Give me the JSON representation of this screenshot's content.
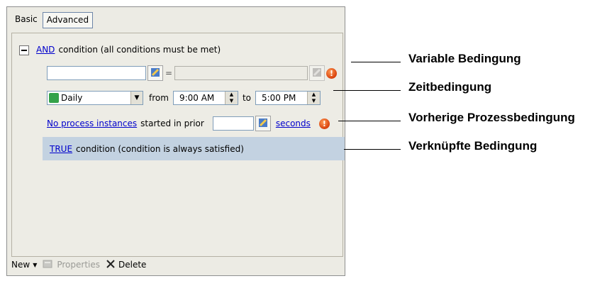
{
  "tabs": [
    {
      "label": "Basic"
    },
    {
      "label": "Advanced"
    }
  ],
  "and_condition": {
    "link": "AND",
    "text": "condition (all conditions must be met)"
  },
  "variable_condition": {
    "left_value": "",
    "equals": "=",
    "right_value": ""
  },
  "time_condition": {
    "frequency": "Daily",
    "from_label": "from",
    "from_time": "9:00 AM",
    "to_label": "to",
    "to_time": "5:00 PM"
  },
  "prior_condition": {
    "link": "No process instances",
    "text": "started in prior",
    "value": "",
    "unit_link": "seconds"
  },
  "true_condition": {
    "link": "TRUE",
    "text": "condition (condition is always satisfied)"
  },
  "toolbar": {
    "new_label": "New",
    "properties_label": "Properties",
    "delete_label": "Delete"
  },
  "callouts": [
    {
      "label": "Variable Bedingung"
    },
    {
      "label": "Zeitbedingung"
    },
    {
      "label": "Vorherige Prozessbedingung"
    },
    {
      "label": "Verknüpfte Bedingung"
    }
  ],
  "colors": {
    "link": "#0000cc",
    "warning": "#d8400c",
    "true_row_bg": "#c3d2e1"
  }
}
